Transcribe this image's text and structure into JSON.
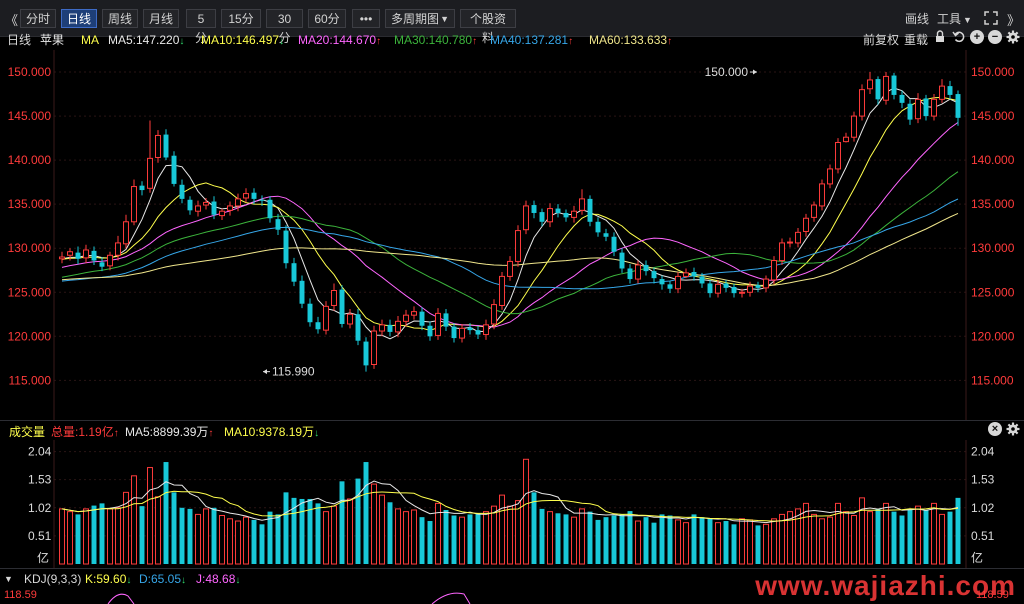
{
  "toolbar": {
    "back_glyph": "《",
    "forward_glyph": "》",
    "periods": [
      "分时",
      "日线",
      "周线",
      "月线",
      "5分",
      "15分",
      "30分",
      "60分"
    ],
    "active_index": 1,
    "more_label": "•••",
    "multi_period_label": "多周期图",
    "multi_period_caret": "▼",
    "stock_info_label": "个股资料",
    "draw_label": "画线",
    "tools_label": "工具",
    "tools_caret": "▼"
  },
  "ma_bar": {
    "period_label": "日线",
    "stock_name": "苹果",
    "indicator": "MA",
    "items": [
      {
        "label": "MA5:147.220",
        "dir": "down",
        "color": "#e8e8e8"
      },
      {
        "label": "MA10:146.497",
        "dir": "down",
        "color": "#ffff4d"
      },
      {
        "label": "MA20:144.670",
        "dir": "up",
        "color": "#ff66ff"
      },
      {
        "label": "MA30:140.780",
        "dir": "up",
        "color": "#3cb43c"
      },
      {
        "label": "MA40:137.281",
        "dir": "up",
        "color": "#36a6e8"
      },
      {
        "label": "MA60:133.633",
        "dir": "up",
        "color": "#f0e68c"
      }
    ],
    "adjust_label": "前复权",
    "reset_label": "重载"
  },
  "volume_bar": {
    "title": "成交量",
    "total_label": "总量:1.19亿",
    "ma5_label": "MA5:8899.39万",
    "ma5_dir": "up",
    "ma10_label": "MA10:9378.19万",
    "ma10_dir": "down"
  },
  "kdj_bar": {
    "title": "KDJ(9,3,3)",
    "k_label": "K:59.60",
    "k_dir": "down",
    "d_label": "D:65.05",
    "d_dir": "down",
    "j_label": "J:48.68",
    "j_dir": "down",
    "axis_value": "118.59"
  },
  "watermark": "www.wajiazhi.com",
  "colors": {
    "up": "#ff3b3b",
    "down": "#18c8d8",
    "ma5": "#e8e8e8",
    "ma10": "#ffff4d",
    "ma20": "#ff66ff",
    "ma30": "#3cb43c",
    "ma40": "#36a6e8",
    "ma60": "#f0e68c"
  },
  "chart_data": {
    "type": "candlestick",
    "price_axis": {
      "ticks": [
        "150.000",
        "145.000",
        "140.000",
        "135.000",
        "130.000",
        "125.000",
        "120.000",
        "115.000"
      ],
      "tick_values": [
        150,
        145,
        140,
        135,
        130,
        125,
        120,
        115
      ],
      "ylim": [
        110.5,
        152.5
      ]
    },
    "annotations": [
      {
        "label": "150.000",
        "price": 150.0,
        "index": 87
      },
      {
        "label": "115.990",
        "price": 115.99,
        "index": 25
      }
    ],
    "close": [
      129.0,
      129.6,
      128.8,
      129.8,
      128.6,
      127.9,
      129.2,
      130.6,
      133.0,
      137.0,
      136.6,
      140.2,
      142.8,
      140.3,
      137.3,
      135.6,
      134.3,
      134.8,
      135.2,
      133.8,
      134.2,
      134.8,
      135.6,
      136.2,
      135.6,
      135.4,
      133.4,
      132.1,
      128.3,
      126.2,
      123.7,
      121.6,
      120.8,
      123.4,
      125.2,
      121.4,
      122.5,
      119.5,
      116.7,
      120.6,
      121.3,
      120.5,
      121.7,
      122.4,
      122.8,
      121.2,
      120.0,
      122.6,
      121.1,
      119.8,
      120.9,
      120.7,
      120.2,
      121.3,
      123.6,
      126.8,
      128.5,
      132.0,
      134.8,
      134.0,
      133.0,
      134.5,
      134.0,
      133.5,
      134.2,
      135.6,
      133.0,
      131.8,
      131.3,
      129.6,
      127.7,
      126.5,
      128.1,
      127.4,
      126.6,
      125.9,
      125.4,
      126.8,
      127.2,
      126.8,
      126.0,
      124.9,
      125.9,
      125.5,
      124.9,
      125.0,
      125.7,
      125.5,
      126.5,
      128.6,
      130.6,
      130.7,
      131.8,
      133.4,
      134.9,
      137.3,
      139.0,
      142.0,
      142.6,
      145.0,
      148.0,
      149.1,
      146.9,
      149.5,
      147.4,
      146.5,
      144.6,
      146.9,
      145.0,
      146.9,
      148.4,
      147.4,
      144.8
    ],
    "open": [
      128.8,
      129.2,
      129.5,
      128.9,
      129.7,
      128.4,
      128.0,
      129.2,
      130.5,
      133.0,
      137.1,
      136.8,
      140.3,
      142.9,
      140.5,
      137.2,
      135.5,
      134.2,
      134.9,
      135.3,
      133.7,
      134.3,
      134.8,
      135.7,
      136.3,
      135.5,
      135.5,
      133.3,
      132.0,
      128.3,
      126.3,
      123.7,
      121.6,
      120.7,
      123.5,
      125.3,
      121.4,
      122.5,
      119.4,
      116.8,
      120.6,
      121.3,
      120.5,
      121.7,
      122.4,
      122.8,
      121.2,
      120.1,
      122.6,
      121.1,
      119.8,
      121.0,
      120.7,
      120.2,
      121.4,
      123.5,
      126.8,
      128.5,
      132.1,
      134.9,
      134.1,
      133.0,
      134.5,
      134.0,
      133.5,
      134.3,
      135.6,
      133.0,
      131.7,
      131.3,
      129.5,
      127.7,
      126.5,
      128.1,
      127.4,
      126.5,
      125.9,
      125.4,
      126.8,
      127.3,
      126.8,
      126.0,
      124.9,
      126.0,
      125.6,
      124.9,
      125.0,
      125.8,
      125.5,
      126.4,
      128.6,
      130.7,
      130.6,
      131.9,
      133.5,
      134.8,
      137.3,
      139.0,
      142.1,
      142.6,
      145.0,
      148.1,
      149.2,
      146.8,
      149.6,
      147.4,
      146.4,
      144.7,
      147.0,
      145.0,
      146.9,
      148.4,
      147.5
    ],
    "high": [
      129.6,
      130.0,
      130.2,
      130.4,
      130.2,
      129.0,
      129.6,
      131.4,
      133.8,
      137.8,
      137.6,
      144.5,
      143.4,
      143.5,
      141.0,
      137.8,
      135.9,
      135.4,
      135.7,
      135.9,
      134.5,
      135.3,
      136.2,
      136.8,
      136.8,
      136.0,
      135.9,
      133.9,
      132.6,
      128.9,
      126.9,
      124.3,
      122.2,
      124.0,
      126.0,
      125.8,
      123.1,
      123.1,
      119.9,
      121.2,
      121.9,
      121.9,
      122.3,
      123.0,
      123.4,
      123.3,
      121.7,
      123.2,
      123.1,
      121.5,
      121.4,
      121.5,
      121.2,
      121.9,
      124.2,
      127.3,
      129.1,
      132.6,
      135.4,
      135.4,
      134.5,
      135.1,
      135.0,
      134.4,
      134.8,
      136.7,
      136.0,
      133.5,
      132.2,
      131.8,
      130.0,
      128.2,
      128.6,
      128.6,
      127.8,
      126.9,
      126.3,
      127.3,
      127.7,
      127.8,
      127.2,
      126.4,
      126.4,
      126.4,
      126.0,
      125.4,
      126.2,
      126.2,
      126.9,
      129.1,
      131.1,
      131.2,
      132.3,
      133.9,
      135.3,
      137.8,
      139.5,
      142.5,
      143.1,
      145.5,
      148.6,
      150.0,
      149.5,
      150.0,
      149.9,
      147.9,
      146.9,
      147.6,
      147.4,
      147.5,
      149.2,
      149.0,
      147.9
    ],
    "low": [
      128.3,
      128.6,
      128.2,
      128.3,
      128.1,
      127.4,
      127.5,
      128.6,
      130.0,
      132.6,
      136.0,
      136.3,
      139.7,
      140.0,
      137.0,
      135.1,
      133.8,
      133.6,
      134.4,
      133.3,
      133.2,
      133.7,
      134.2,
      135.2,
      135.0,
      134.8,
      132.9,
      131.5,
      127.7,
      125.7,
      123.2,
      121.1,
      120.3,
      120.2,
      122.9,
      121.0,
      120.9,
      119.0,
      115.99,
      116.3,
      120.0,
      120.0,
      119.9,
      121.1,
      121.9,
      120.7,
      119.5,
      119.6,
      120.6,
      119.3,
      119.3,
      120.2,
      119.7,
      119.6,
      120.8,
      123.0,
      126.3,
      127.9,
      131.6,
      133.4,
      132.5,
      132.4,
      133.5,
      133.0,
      132.9,
      133.8,
      132.5,
      131.3,
      130.8,
      129.1,
      127.2,
      126.0,
      126.0,
      126.9,
      126.0,
      125.3,
      124.9,
      124.9,
      126.6,
      126.3,
      125.5,
      124.4,
      124.4,
      125.0,
      124.4,
      124.4,
      124.5,
      125.0,
      125.0,
      125.9,
      128.1,
      130.1,
      130.1,
      131.3,
      133.0,
      134.3,
      136.8,
      138.5,
      142.0,
      142.1,
      144.5,
      147.5,
      146.3,
      146.3,
      146.9,
      145.9,
      144.0,
      144.2,
      144.5,
      144.5,
      146.5,
      146.9,
      143.9
    ],
    "volume_axis": {
      "ticks": [
        "2.04",
        "1.53",
        "1.02",
        "0.51"
      ],
      "tick_values": [
        2.04,
        1.53,
        1.02,
        0.51
      ],
      "unit": "亿",
      "ylim": [
        0,
        2.25
      ]
    },
    "volume": [
      1.0,
      0.95,
      0.9,
      1.0,
      1.06,
      1.1,
      1.0,
      1.02,
      1.3,
      1.6,
      1.05,
      1.75,
      1.22,
      1.85,
      1.3,
      1.02,
      1.0,
      0.9,
      1.0,
      1.02,
      0.88,
      0.82,
      0.78,
      0.85,
      0.8,
      0.72,
      0.95,
      0.9,
      1.3,
      1.2,
      1.18,
      1.18,
      1.1,
      0.95,
      1.05,
      1.5,
      1.18,
      1.55,
      1.85,
      1.45,
      1.25,
      1.12,
      1.0,
      0.95,
      0.98,
      0.85,
      0.78,
      1.1,
      0.98,
      0.88,
      0.85,
      0.9,
      0.92,
      0.95,
      1.05,
      1.25,
      1.05,
      1.15,
      1.9,
      1.3,
      1.0,
      0.95,
      0.92,
      0.9,
      0.85,
      1.0,
      0.95,
      0.8,
      0.85,
      0.88,
      0.9,
      0.96,
      0.78,
      0.85,
      0.75,
      0.9,
      0.88,
      0.8,
      0.75,
      0.9,
      0.85,
      0.82,
      0.75,
      0.78,
      0.72,
      0.82,
      0.8,
      0.7,
      0.72,
      0.82,
      0.9,
      0.95,
      1.0,
      1.1,
      0.9,
      0.82,
      0.85,
      1.1,
      0.95,
      0.88,
      1.2,
      0.95,
      1.0,
      1.1,
      0.95,
      0.88,
      1.0,
      1.05,
      0.98,
      1.1,
      0.9,
      0.95,
      1.2
    ],
    "volume_ma5_label": "MA5:8899.39万",
    "volume_ma10_label": "MA10:9378.19万"
  }
}
